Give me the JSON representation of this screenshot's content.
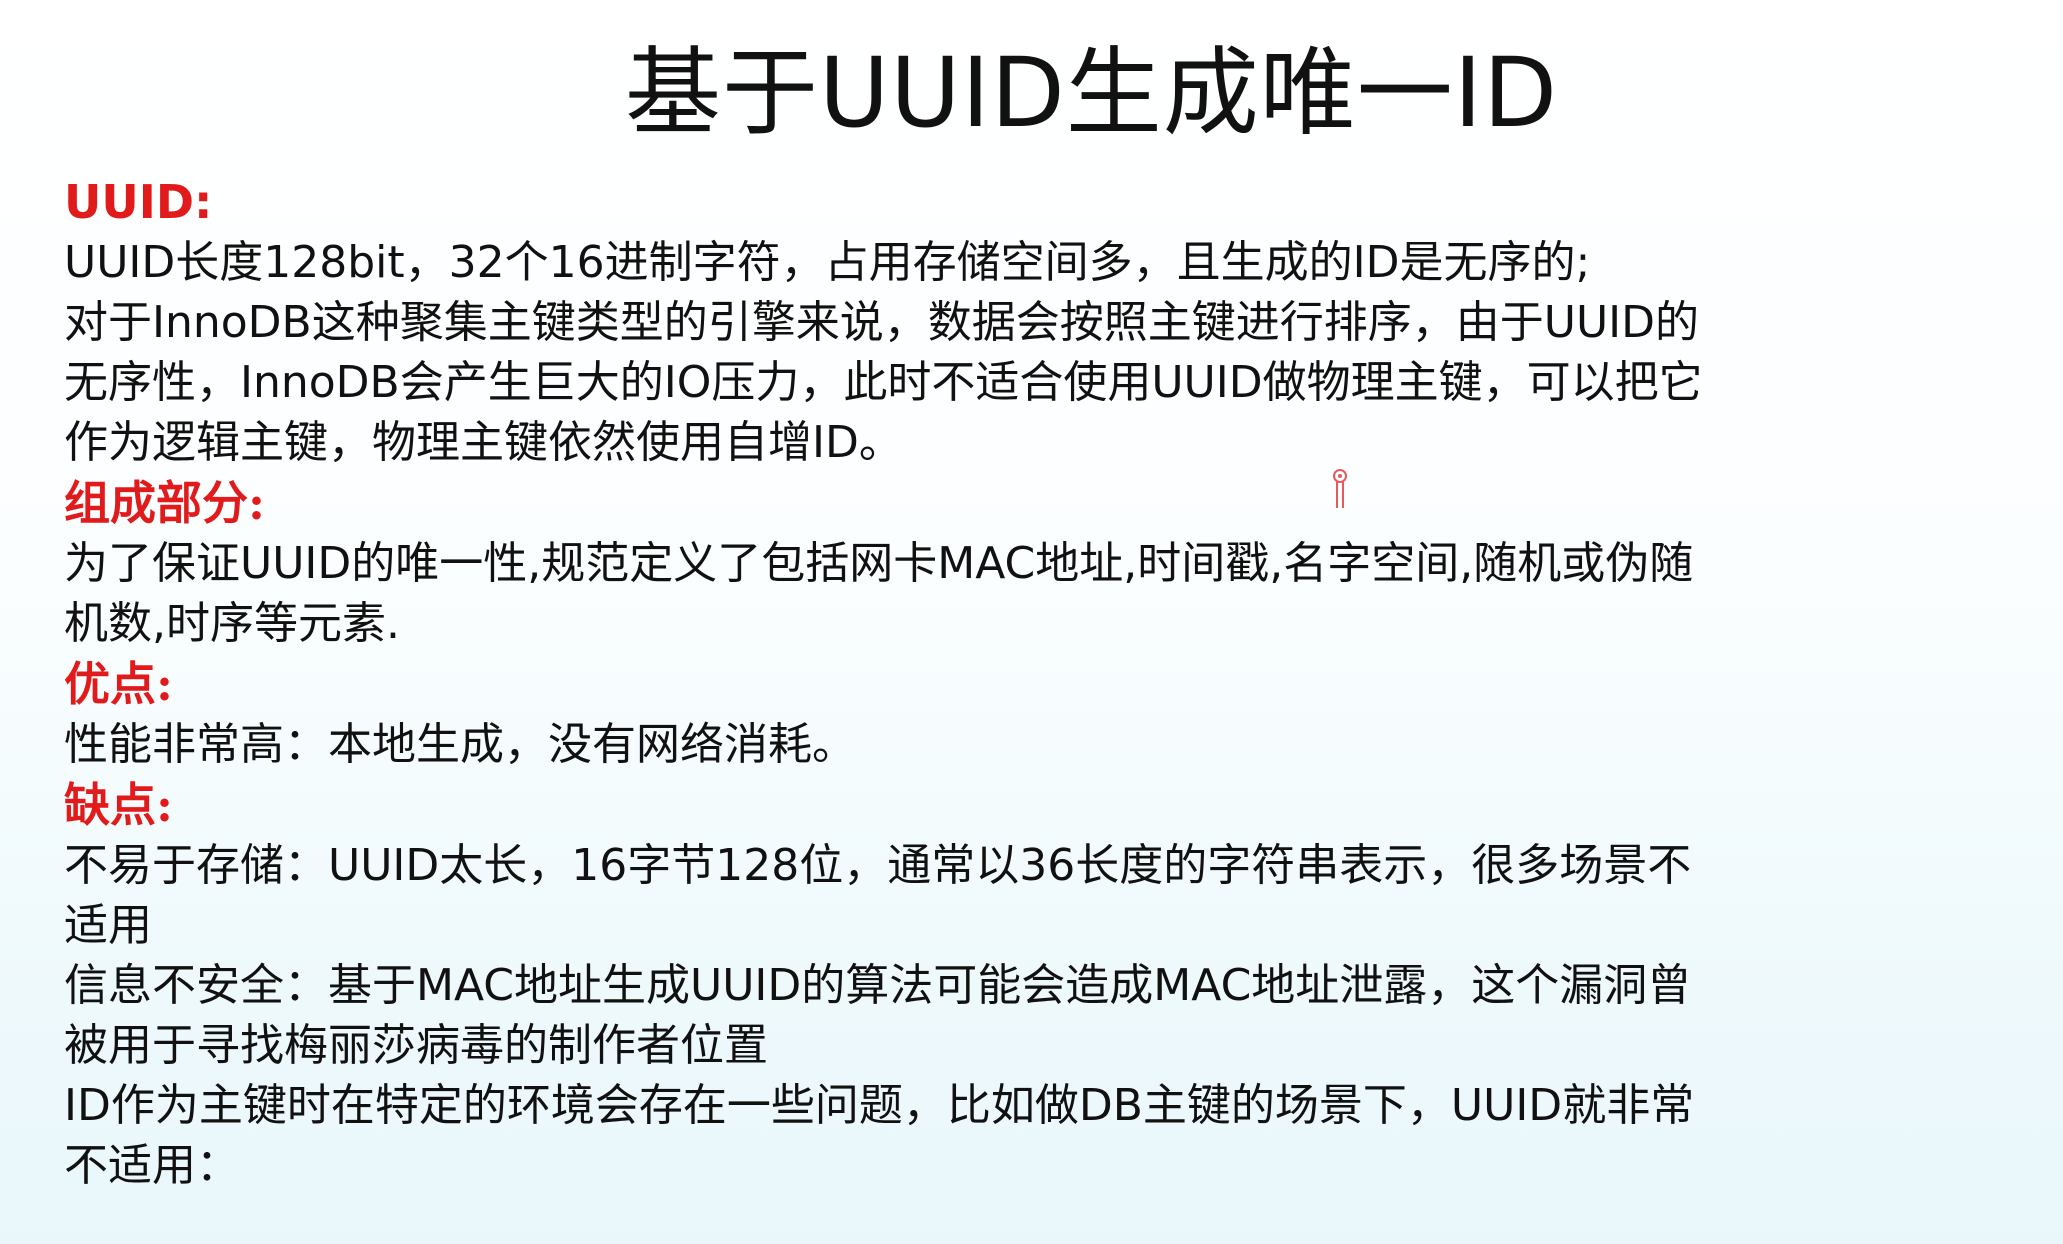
{
  "title": "基于UUID生成唯一ID",
  "sections": [
    {
      "heading": "UUID:",
      "paragraphs": [
        "UUID长度128bit，32个16进制字符，占用存储空间多，且生成的ID是无序的;\n对于InnoDB这种聚集主键类型的引擎来说，数据会按照主键进行排序，由于UUID的\n无序性，InnoDB会产生巨大的IO压力，此时不适合使用UUID做物理主键，可以把它\n作为逻辑主键，物理主键依然使用自增ID。"
      ]
    },
    {
      "heading": "组成部分:",
      "paragraphs": [
        "为了保证UUID的唯一性,规范定义了包括网卡MAC地址,时间戳,名字空间,随机或伪随\n机数,时序等元素."
      ]
    },
    {
      "heading": "优点:",
      "paragraphs": [
        "性能非常高：本地生成，没有网络消耗。"
      ]
    },
    {
      "heading": "缺点:",
      "paragraphs": [
        "不易于存储：UUID太长，16字节128位，通常以36长度的字符串表示，很多场景不\n适用",
        "信息不安全：基于MAC地址生成UUID的算法可能会造成MAC地址泄露，这个漏洞曾\n被用于寻找梅丽莎病毒的制作者位置",
        "ID作为主键时在特定的环境会存在一些问题，比如做DB主键的场景下，UUID就非常\n不适用："
      ]
    }
  ],
  "colors": {
    "heading": "#e11b1b",
    "text": "#111111",
    "pin": "#e85a5a"
  },
  "icons": {
    "cursor": "pushpin-cursor-icon"
  }
}
